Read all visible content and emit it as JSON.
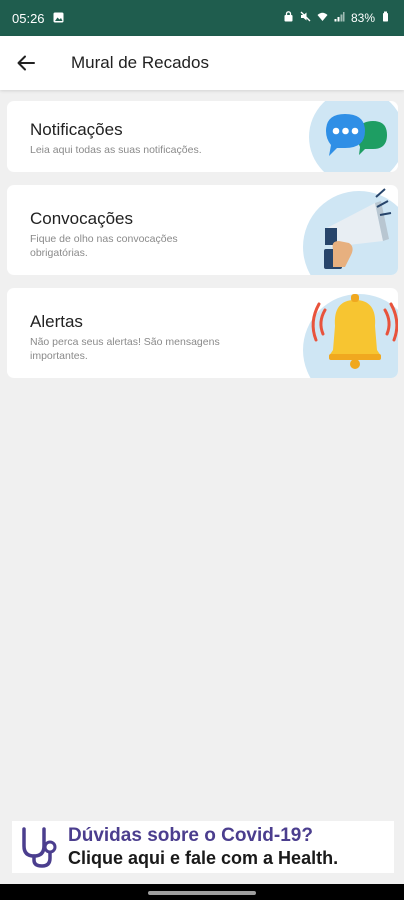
{
  "status_bar": {
    "time": "05:26",
    "battery": "83%",
    "icons": [
      "image-icon",
      "lock-icon",
      "mute-icon",
      "wifi-icon",
      "signal-icon",
      "battery-icon"
    ]
  },
  "app_bar": {
    "back_icon": "arrow-left-icon",
    "title": "Mural de Recados"
  },
  "cards": [
    {
      "title": "Notificações",
      "description": "Leia aqui todas as suas notificações.",
      "icon": "chat-bubbles-icon"
    },
    {
      "title": "Convocações",
      "description": "Fique de olho nas convocações obrigatórias.",
      "icon": "megaphone-icon"
    },
    {
      "title": "Alertas",
      "description": "Não perca seus alertas! São mensagens importantes.",
      "icon": "bell-icon"
    }
  ],
  "banner": {
    "line1": "Dúvidas sobre o Covid-19?",
    "line2": "Clique aqui e fale com a Health.",
    "icon": "stethoscope-icon"
  },
  "colors": {
    "status_bar": "#1f5d4e",
    "card_art_bg": "#cfe6f4",
    "banner_purple": "#4b3e8e"
  }
}
